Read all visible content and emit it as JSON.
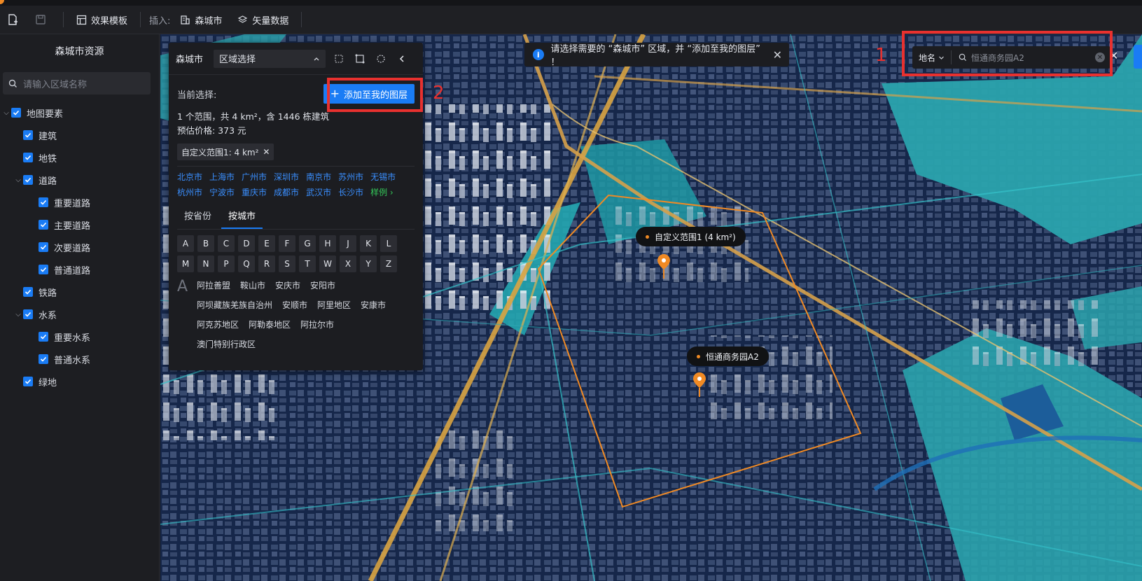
{
  "toolbar": {
    "effect_template": "效果模板",
    "insert_label": "插入:",
    "city_btn": "森城市",
    "vector_btn": "矢量数据"
  },
  "sidebar": {
    "title": "森城市资源",
    "search_placeholder": "请输入区域名称",
    "tree": [
      {
        "label": "地图要素",
        "level": 0,
        "expandable": true
      },
      {
        "label": "建筑",
        "level": 1,
        "expandable": false
      },
      {
        "label": "地铁",
        "level": 1,
        "expandable": false
      },
      {
        "label": "道路",
        "level": 1,
        "expandable": true
      },
      {
        "label": "重要道路",
        "level": 2,
        "expandable": false
      },
      {
        "label": "主要道路",
        "level": 2,
        "expandable": false
      },
      {
        "label": "次要道路",
        "level": 2,
        "expandable": false
      },
      {
        "label": "普通道路",
        "level": 2,
        "expandable": false
      },
      {
        "label": "铁路",
        "level": 1,
        "expandable": false
      },
      {
        "label": "水系",
        "level": 1,
        "expandable": true
      },
      {
        "label": "重要水系",
        "level": 2,
        "expandable": false
      },
      {
        "label": "普通水系",
        "level": 2,
        "expandable": false
      },
      {
        "label": "绿地",
        "level": 1,
        "expandable": false
      }
    ]
  },
  "panel": {
    "city": "森城市",
    "region_select": "区域选择",
    "current_label": "当前选择:",
    "add_button": "添加至我的图层",
    "summary": "1 个范围，共 4 km²，含 1446 栋建筑",
    "price": "预估价格: 373 元",
    "tag": "自定义范围1: 4 km²",
    "cities": [
      "北京市",
      "上海市",
      "广州市",
      "深圳市",
      "南京市",
      "苏州市",
      "无锡市",
      "杭州市",
      "宁波市",
      "重庆市",
      "成都市",
      "武汉市",
      "长沙市"
    ],
    "sample": "样例 ›",
    "tabs": [
      "按省份",
      "按城市"
    ],
    "letters": [
      "A",
      "B",
      "C",
      "D",
      "E",
      "F",
      "G",
      "H",
      "J",
      "K",
      "L",
      "M",
      "N",
      "P",
      "Q",
      "R",
      "S",
      "T",
      "W",
      "X",
      "Y",
      "Z"
    ],
    "list_letter": "A",
    "list_items": [
      "阿拉善盟",
      "鞍山市",
      "安庆市",
      "安阳市",
      "阿坝藏族羌族自治州",
      "安顺市",
      "阿里地区",
      "安康市",
      "阿克苏地区",
      "阿勒泰地区",
      "阿拉尔市",
      "澳门特别行政区"
    ]
  },
  "notice": {
    "text": "请选择需要的 “森城市” 区域，并 “添加至我的图层” ！"
  },
  "poi_search": {
    "type": "地名",
    "value": "恒通商务园A2"
  },
  "callouts": {
    "range": "自定义范围1 (4 km²)",
    "poi": "恒通商务园A2"
  },
  "annotations": {
    "one": "1",
    "two": "2"
  },
  "colors": {
    "accent": "#1a7cf5",
    "annotation": "#e8312f",
    "range_outline": "#f08a24"
  }
}
